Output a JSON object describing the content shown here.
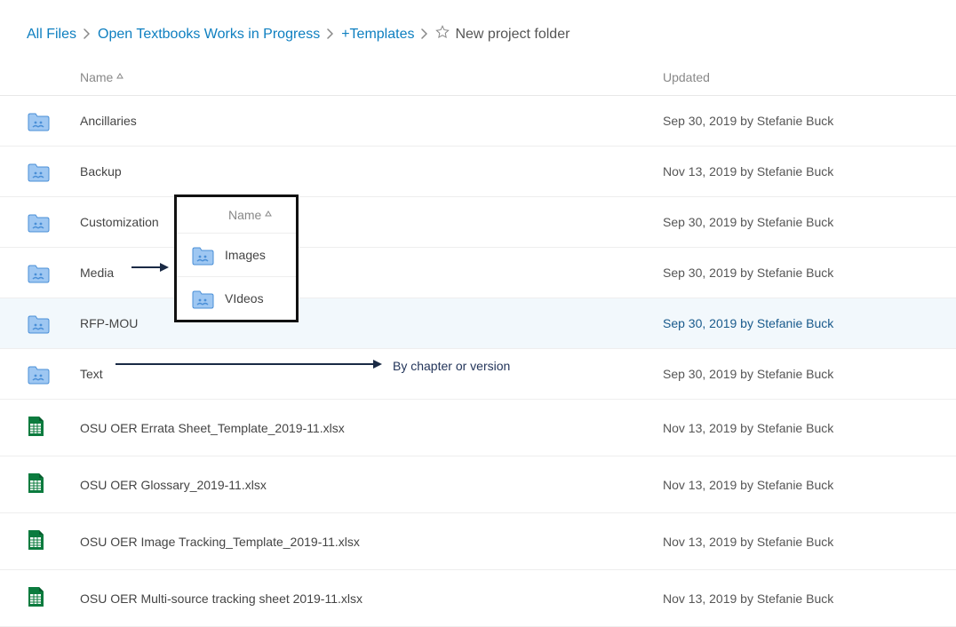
{
  "breadcrumb": {
    "items": [
      {
        "label": "All Files"
      },
      {
        "label": "Open Textbooks Works in Progress"
      },
      {
        "label": "+Templates"
      }
    ],
    "current": "New project folder"
  },
  "columns": {
    "name": "Name",
    "updated": "Updated"
  },
  "rows": [
    {
      "type": "folder",
      "name": "Ancillaries",
      "updated": "Sep 30, 2019 by Stefanie Buck",
      "active": false
    },
    {
      "type": "folder",
      "name": "Backup",
      "updated": "Nov 13, 2019 by Stefanie Buck",
      "active": false
    },
    {
      "type": "folder",
      "name": "Customization",
      "updated": "Sep 30, 2019 by Stefanie Buck",
      "active": false
    },
    {
      "type": "folder",
      "name": "Media",
      "updated": "Sep 30, 2019 by Stefanie Buck",
      "active": false
    },
    {
      "type": "folder",
      "name": "RFP-MOU",
      "updated": "Sep 30, 2019 by Stefanie Buck",
      "active": true
    },
    {
      "type": "folder",
      "name": "Text",
      "updated": "Sep 30, 2019 by Stefanie Buck",
      "active": false
    },
    {
      "type": "xlsx",
      "name": "OSU OER Errata Sheet_Template_2019-11.xlsx",
      "updated": "Nov 13, 2019 by Stefanie Buck",
      "active": false
    },
    {
      "type": "xlsx",
      "name": "OSU OER Glossary_2019-11.xlsx",
      "updated": "Nov 13, 2019 by Stefanie Buck",
      "active": false
    },
    {
      "type": "xlsx",
      "name": "OSU OER Image Tracking_Template_2019-11.xlsx",
      "updated": "Nov 13, 2019 by Stefanie Buck",
      "active": false
    },
    {
      "type": "xlsx",
      "name": "OSU OER Multi-source tracking sheet 2019-11.xlsx",
      "updated": "Nov 13, 2019 by Stefanie Buck",
      "active": false
    }
  ],
  "popup": {
    "header": "Name",
    "items": [
      {
        "name": "Images"
      },
      {
        "name": "VIdeos"
      }
    ]
  },
  "annotations": {
    "text_note": "By chapter or version"
  }
}
